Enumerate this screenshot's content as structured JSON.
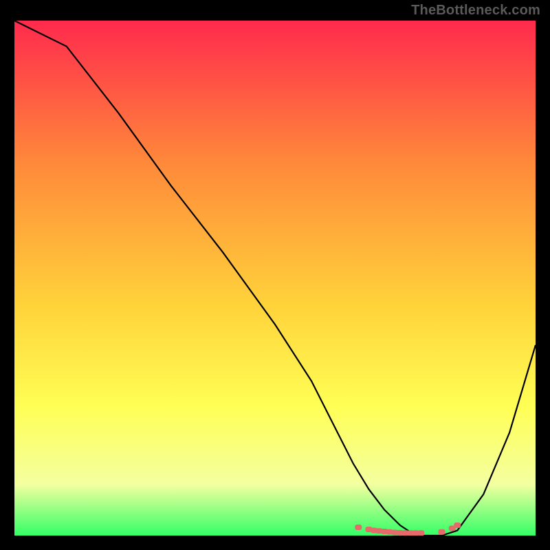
{
  "watermark": "TheBottleneck.com",
  "colors": {
    "bg": "#000000",
    "gradient_top": "#ff2a4d",
    "gradient_mid1": "#ff8a3a",
    "gradient_mid2": "#ffd23a",
    "gradient_mid3": "#ffff55",
    "gradient_mid4": "#f4ffa0",
    "gradient_bottom": "#33ff66",
    "curve": "#000000",
    "marker": "#e66a6a"
  },
  "chart_data": {
    "type": "line",
    "title": "",
    "xlabel": "",
    "ylabel": "",
    "xlim": [
      0,
      100
    ],
    "ylim": [
      0,
      100
    ],
    "series": [
      {
        "name": "bottleneck-curve",
        "x": [
          0,
          6,
          10,
          20,
          30,
          40,
          50,
          57,
          62,
          65,
          68,
          71,
          74,
          77,
          80,
          82,
          85,
          90,
          95,
          100
        ],
        "y": [
          100,
          97,
          95,
          82,
          68,
          55,
          41,
          30,
          20,
          14,
          9,
          5,
          2,
          0,
          0,
          0,
          1,
          8,
          20,
          37
        ]
      }
    ],
    "markers": {
      "name": "flat-plateau-dots",
      "x": [
        66,
        68,
        69,
        70,
        71,
        72,
        73,
        74,
        75,
        76,
        77,
        78,
        82,
        84,
        85
      ],
      "y": [
        1.6,
        1.2,
        1.0,
        0.9,
        0.8,
        0.7,
        0.6,
        0.55,
        0.52,
        0.5,
        0.5,
        0.5,
        0.7,
        1.4,
        2.0
      ]
    }
  }
}
